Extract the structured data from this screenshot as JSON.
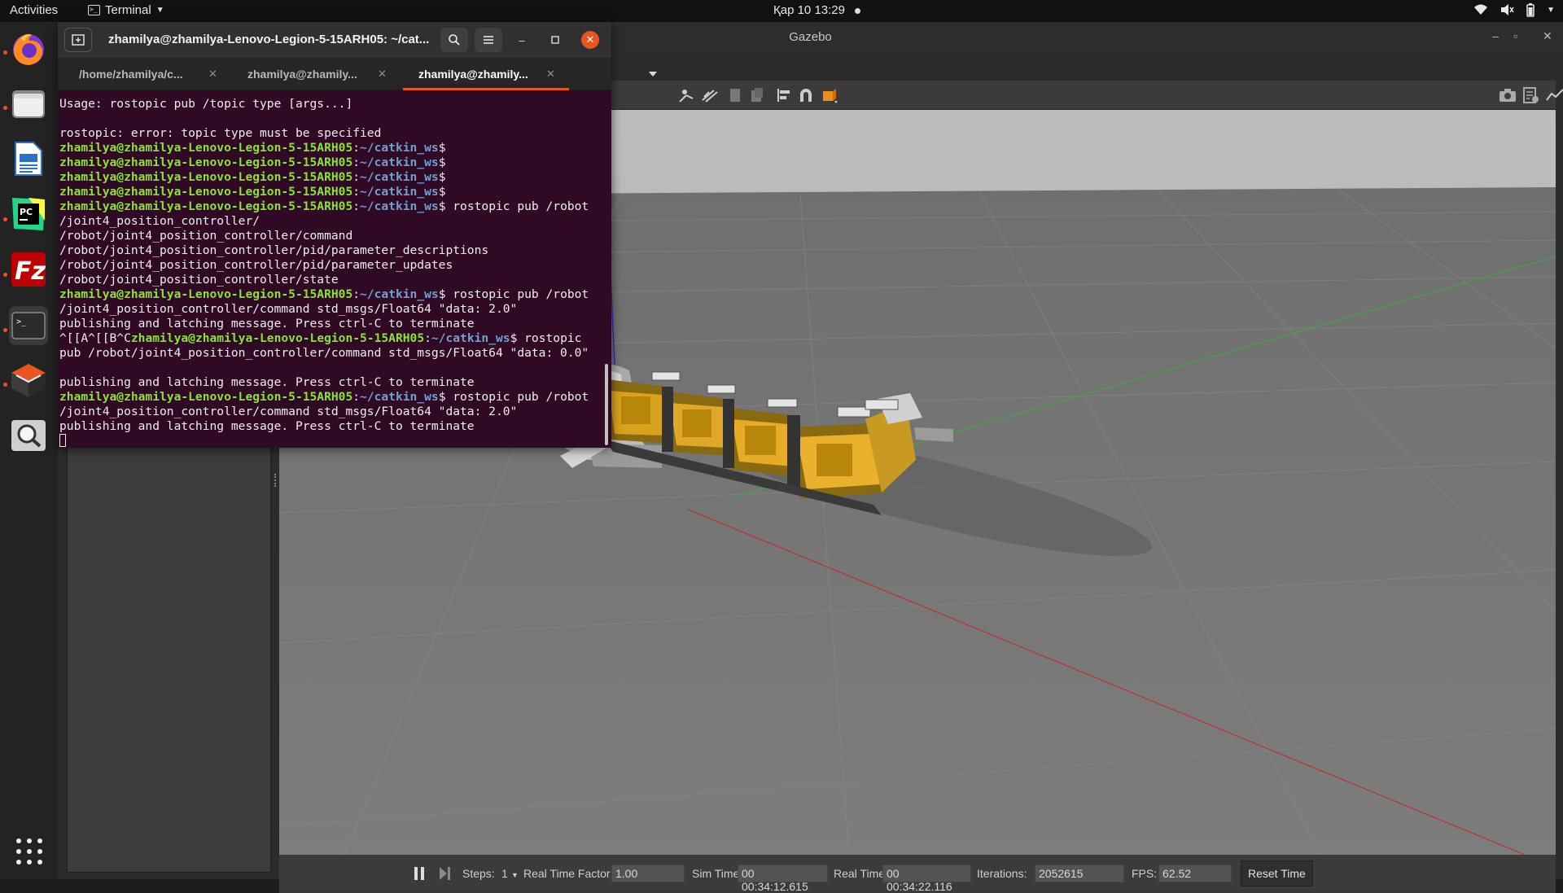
{
  "topbar": {
    "activities": "Activities",
    "app_name": "Terminal",
    "clock": "Қар 10  13:29"
  },
  "dock": {
    "items": [
      {
        "name": "firefox",
        "icon": "firefox-icon"
      },
      {
        "name": "files",
        "icon": "folder-icon"
      },
      {
        "name": "writer",
        "icon": "document-icon"
      },
      {
        "name": "pycharm",
        "icon": "pycharm-icon"
      },
      {
        "name": "filezilla",
        "icon": "filezilla-icon"
      },
      {
        "name": "terminal",
        "icon": "terminal-icon"
      },
      {
        "name": "software",
        "icon": "box-icon"
      },
      {
        "name": "search",
        "icon": "magnifier-icon"
      }
    ]
  },
  "gazebo": {
    "title": "Gazebo",
    "bottom": {
      "steps_label": "Steps:",
      "steps_value": "1",
      "rtf_label": "Real Time Factor:",
      "rtf_value": "1.00",
      "sim_label": "Sim Time:",
      "sim_value": "00 00:34:12.615",
      "real_label": "Real Time:",
      "real_value": "00 00:34:22.116",
      "iter_label": "Iterations:",
      "iter_value": "2052615",
      "fps_label": "FPS:",
      "fps_value": "62.52",
      "reset_label": "Reset Time"
    }
  },
  "terminal": {
    "title": "zhamilya@zhamilya-Lenovo-Legion-5-15ARH05: ~/cat...",
    "tabs": [
      {
        "label": "/home/zhamilya/c..."
      },
      {
        "label": "zhamilya@zhamily..."
      },
      {
        "label": "zhamilya@zhamily..."
      }
    ],
    "prompt_user": "zhamilya@zhamilya-Lenovo-Legion-5-15ARH05",
    "prompt_path": "~/catkin_ws",
    "lines": {
      "l1": "Usage: rostopic pub /topic type [args...]",
      "l3": "rostopic: error: topic type must be specified",
      "l8_cmd": " rostopic pub /robot",
      "l9": "/joint4_position_controller/",
      "l10": "/robot/joint4_position_controller/command",
      "l11": "/robot/joint4_position_controller/pid/parameter_descriptions",
      "l12": "/robot/joint4_position_controller/pid/parameter_updates",
      "l13": "/robot/joint4_position_controller/state",
      "l14_cmd": " rostopic pub /robot",
      "l15": "/joint4_position_controller/command std_msgs/Float64 \"data: 2.0\"",
      "l16": "publishing and latching message. Press ctrl-C to terminate",
      "l17_pre": "^[[A^[[B^C",
      "l17_cmd": " rostopic",
      "l18": "pub /robot/joint4_position_controller/command std_msgs/Float64 \"data: 0.0\"",
      "l20": "publishing and latching message. Press ctrl-C to terminate",
      "l21_cmd": " rostopic pub /robot",
      "l22": "/joint4_position_controller/command std_msgs/Float64 \"data: 2.0\"",
      "l23": "publishing and latching message. Press ctrl-C to terminate"
    }
  }
}
